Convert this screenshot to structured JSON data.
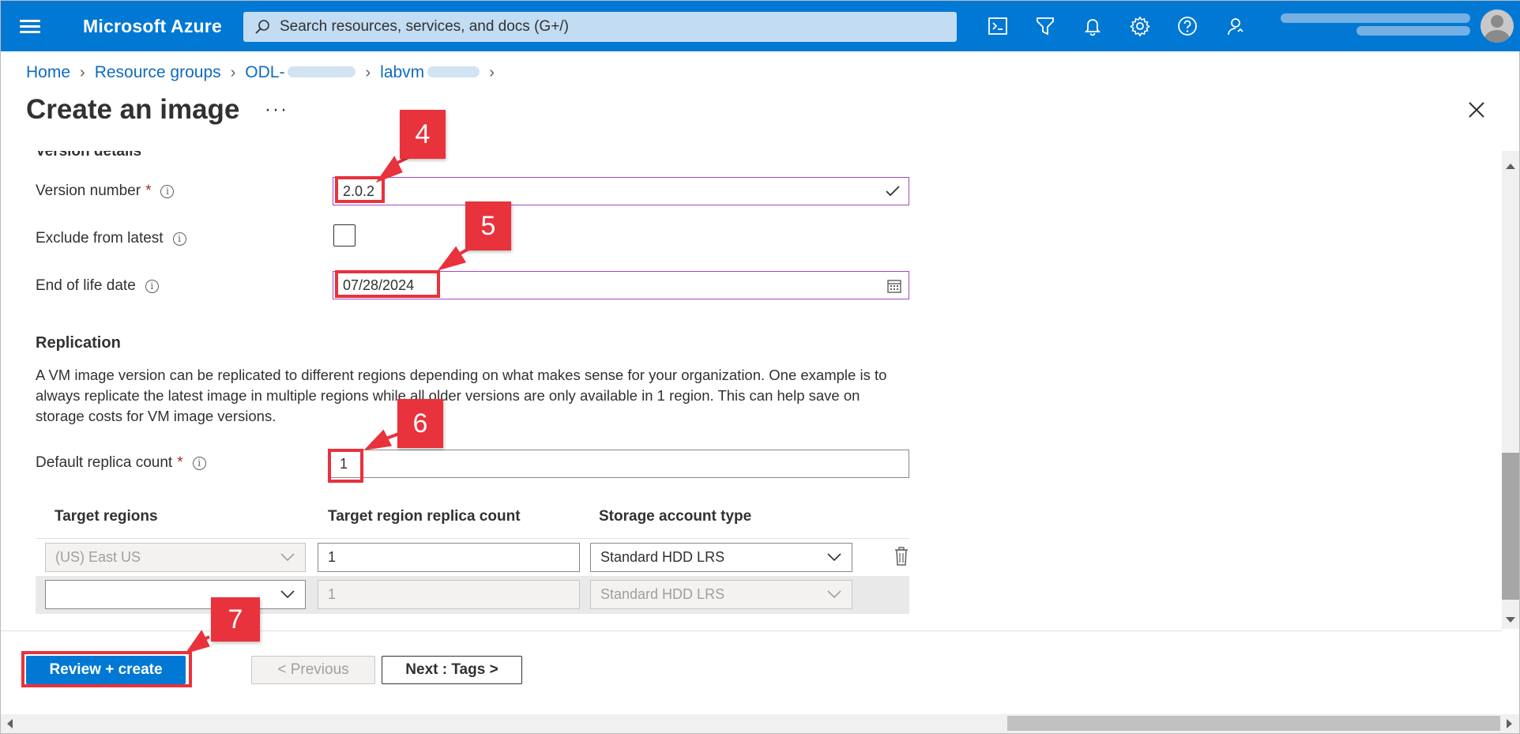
{
  "topbar": {
    "brand": "Microsoft Azure",
    "search_placeholder": "Search resources, services, and docs (G+/)"
  },
  "breadcrumb": {
    "items": [
      "Home",
      "Resource groups",
      "ODL-",
      "labvm"
    ]
  },
  "page": {
    "title": "Create an image",
    "more": "···"
  },
  "version_details": {
    "heading": "Version details",
    "version_number_label": "Version number",
    "version_number_value": "2.0.2",
    "exclude_label": "Exclude from latest",
    "end_of_life_label": "End of life date",
    "end_of_life_value": "07/28/2024"
  },
  "replication": {
    "title": "Replication",
    "description": "A VM image version can be replicated to different regions depending on what makes sense for your organization. One example is to always replicate the latest image in multiple regions while all older versions are only available in 1 region. This can help save on storage costs for VM image versions.",
    "default_replica_label": "Default replica count",
    "default_replica_value": "1",
    "table": {
      "headers": [
        "Target regions",
        "Target region replica count",
        "Storage account type"
      ],
      "rows": [
        {
          "region": "(US) East US",
          "count": "1",
          "storage": "Standard HDD LRS"
        },
        {
          "region": "",
          "count": "1",
          "storage": "Standard HDD LRS"
        }
      ]
    }
  },
  "footer": {
    "review_create": "Review + create",
    "previous": "< Previous",
    "next": "Next : Tags >"
  },
  "callouts": [
    "4",
    "5",
    "6",
    "7"
  ],
  "colors": {
    "azure_blue": "#0078d4",
    "callout_red": "#e8323c",
    "focus_purple": "#a347c3"
  }
}
